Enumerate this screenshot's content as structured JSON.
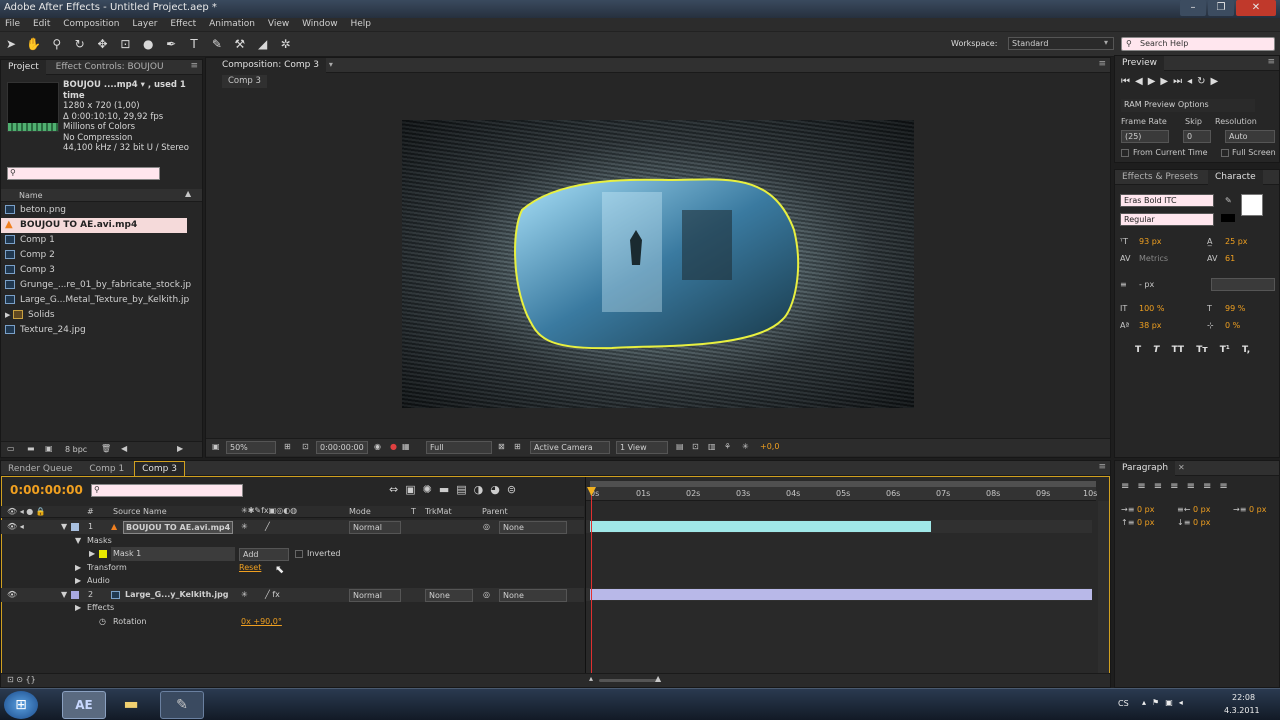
{
  "window": {
    "title": "Adobe After Effects - Untitled Project.aep *",
    "min": "–",
    "max": "❐",
    "close": "✕"
  },
  "menu": [
    "File",
    "Edit",
    "Composition",
    "Layer",
    "Effect",
    "Animation",
    "View",
    "Window",
    "Help"
  ],
  "toolbar": {
    "workspace_label": "Workspace:",
    "workspace_value": "Standard",
    "search_placeholder": "Search Help"
  },
  "project": {
    "tabs": [
      "Project",
      "Effect Controls: BOUJOU"
    ],
    "info": {
      "name": "BOUJOU ....mp4 ▾ , used 1 time",
      "lines": [
        "1280 x 720 (1,00)",
        "Δ 0:00:10:10, 29,92 fps",
        "Millions of Colors",
        "No Compression",
        "44,100 kHz / 32 bit U / Stereo"
      ]
    },
    "column_name": "Name",
    "items": [
      {
        "label": "beton.png",
        "kind": "image"
      },
      {
        "label": "BOUJOU TO AE.avi.mp4",
        "kind": "video",
        "selected": true
      },
      {
        "label": "Comp 1",
        "kind": "comp"
      },
      {
        "label": "Comp 2",
        "kind": "comp"
      },
      {
        "label": "Comp 3",
        "kind": "comp"
      },
      {
        "label": "Grunge_...re_01_by_fabricate_stock.jp",
        "kind": "image"
      },
      {
        "label": "Large_G...Metal_Texture_by_Kelkith.jp",
        "kind": "image"
      },
      {
        "label": "Solids",
        "kind": "folder"
      },
      {
        "label": "Texture_24.jpg",
        "kind": "image"
      }
    ],
    "footer_bpc": "8 bpc"
  },
  "composition": {
    "tab": "Composition: Comp 3",
    "subtab": "Comp 3",
    "zoom": "50%",
    "timecode": "0:00:00:00",
    "resolution": "Full",
    "camera": "Active Camera",
    "views": "1 View",
    "exposure": "+0,0"
  },
  "preview": {
    "tab": "Preview",
    "ram_options": "RAM Preview Options",
    "frame_rate_label": "Frame Rate",
    "skip_label": "Skip",
    "resolution_label": "Resolution",
    "frame_rate": "(25)",
    "skip": "0",
    "resolution": "Auto",
    "from_current": "From Current Time",
    "full_screen": "Full Screen"
  },
  "character": {
    "tabs": [
      "Effects & Presets",
      "Characte"
    ],
    "font": "Eras Bold ITC",
    "style": "Regular",
    "size": "93 px",
    "leading": "25 px",
    "kerning": "Metrics",
    "tracking": "61",
    "stroke": "- px",
    "vscale": "100 %",
    "hscale": "99 %",
    "baseline": "38 px",
    "tsume": "0 %",
    "styles": [
      "T",
      "T",
      "TT",
      "Tт",
      "T¹",
      "T,"
    ]
  },
  "paragraph": {
    "tab": "Paragraph",
    "values": [
      "0 px",
      "0 px",
      "0 px",
      "0 px",
      "0 px"
    ]
  },
  "timeline": {
    "tabs": [
      "Render Queue",
      "Comp 1",
      "Comp 3"
    ],
    "timecode": "0:00:00:00",
    "columns": {
      "source": "Source Name",
      "mode": "Mode",
      "t": "T",
      "trkmat": "TrkMat",
      "parent": "Parent"
    },
    "ruler": [
      "0s",
      "01s",
      "02s",
      "03s",
      "04s",
      "05s",
      "06s",
      "07s",
      "08s",
      "09s",
      "10s"
    ],
    "layers": [
      {
        "num": "1",
        "name": "BOUJOU TO AE.avi.mp4",
        "mode": "Normal",
        "trkmat": "",
        "parent": "None",
        "bar_end": 0.68,
        "bar_color": "#a0e8e8"
      },
      {
        "num": "2",
        "name": "Large_G...y_Kelkith.jpg",
        "mode": "Normal",
        "trkmat": "None",
        "parent": "None",
        "bar_end": 1.0,
        "bar_color": "#b8b8e8"
      }
    ],
    "masks_label": "Masks",
    "mask1": "Mask 1",
    "mask_mode": "Add",
    "inverted": "Inverted",
    "transform": "Transform",
    "reset": "Reset",
    "audio": "Audio",
    "effects": "Effects",
    "rotation": "Rotation",
    "rotation_value": "0x +90,0°"
  },
  "taskbar": {
    "lang": "CS",
    "time": "22:08",
    "date": "4.3.2011",
    "ae": "AE"
  }
}
